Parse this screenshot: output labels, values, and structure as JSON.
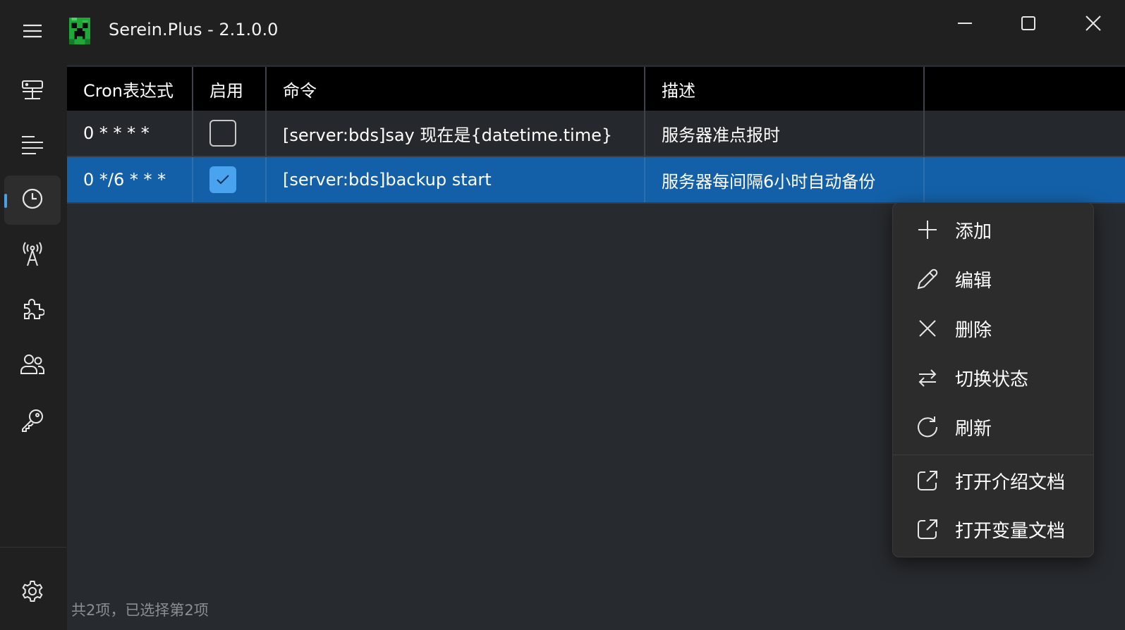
{
  "app": {
    "title": "Serein.Plus - 2.1.0.0"
  },
  "nav": {
    "items": [
      "server-icon",
      "console-list-icon",
      "clock-icon",
      "antenna-icon",
      "puzzle-icon",
      "users-icon",
      "key-icon"
    ],
    "active": "clock-icon",
    "bottom": "gear-icon"
  },
  "table": {
    "columns": [
      "Cron表达式",
      "启用",
      "命令",
      "描述",
      ""
    ],
    "rows": [
      {
        "cron": "0 * * * *",
        "enabled": false,
        "command": "[server:bds]say 现在是{datetime.time}",
        "description": "服务器准点报时"
      },
      {
        "cron": "0 */6 * * *",
        "enabled": true,
        "command": "[server:bds]backup start",
        "description": "服务器每间隔6小时自动备份",
        "selected": true
      }
    ]
  },
  "status": {
    "text": "共2项，已选择第2项"
  },
  "context_menu": {
    "items": [
      {
        "label": "添加",
        "icon": "plus-icon"
      },
      {
        "label": "编辑",
        "icon": "pencil-icon"
      },
      {
        "label": "删除",
        "icon": "x-icon"
      },
      {
        "label": "切换状态",
        "icon": "swap-icon"
      },
      {
        "label": "刷新",
        "icon": "refresh-icon"
      },
      {
        "label": "打开介绍文档",
        "icon": "external-link-icon"
      },
      {
        "label": "打开变量文档",
        "icon": "external-link-icon"
      }
    ]
  },
  "colors": {
    "selected_row": "#1460a8",
    "accent": "#4aa3ee",
    "background": "#272a2e",
    "header_bg": "#000000"
  }
}
